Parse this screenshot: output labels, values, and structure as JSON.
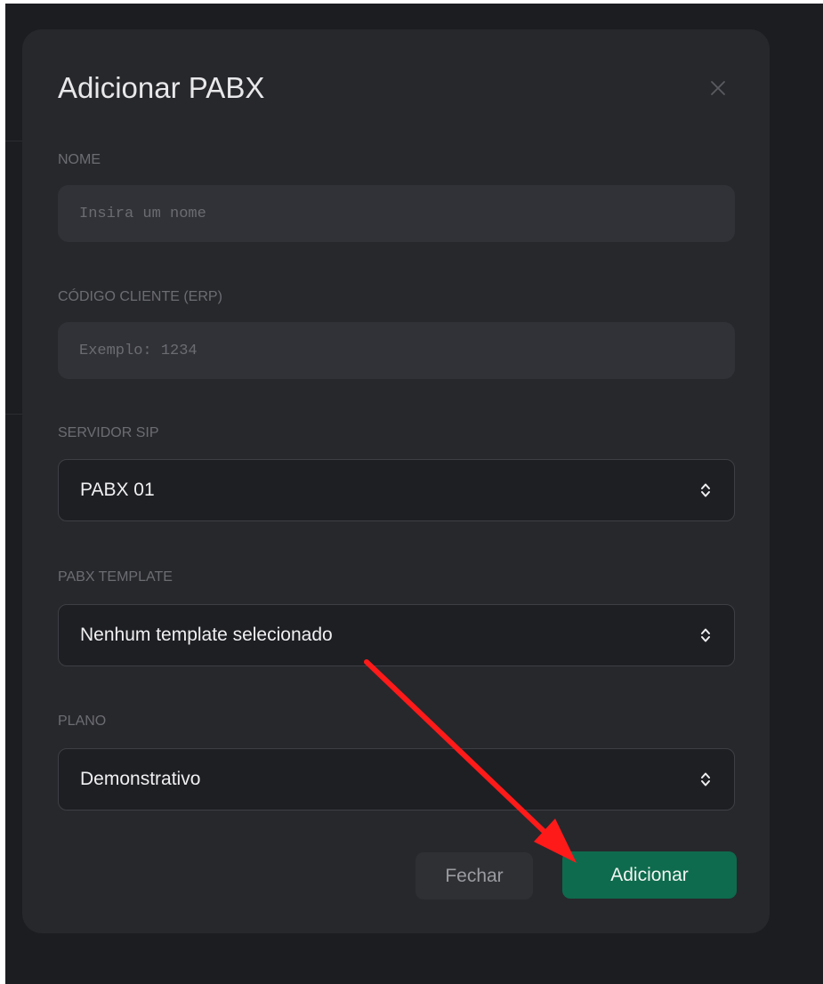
{
  "modal": {
    "title": "Adicionar PABX"
  },
  "form": {
    "nome": {
      "label": "NOME",
      "value": "",
      "placeholder": "Insira um nome"
    },
    "codigo_cliente": {
      "label": "CÓDIGO CLIENTE (ERP)",
      "value": "",
      "placeholder": "Exemplo: 1234"
    },
    "servidor_sip": {
      "label": "SERVIDOR SIP",
      "selected": "PABX 01"
    },
    "pabx_template": {
      "label": "PABX TEMPLATE",
      "selected": "Nenhum template selecionado"
    },
    "plano": {
      "label": "PLANO",
      "selected": "Demonstrativo"
    }
  },
  "actions": {
    "close_label": "Fechar",
    "submit_label": "Adicionar"
  },
  "colors": {
    "modal_background": "#27282c",
    "page_background": "#1c1d21",
    "primary_button": "#0e6b4d",
    "annotation_arrow": "#ff1a1a"
  },
  "icons": {
    "close": "close-icon",
    "select": "chevron-up-down-icon"
  }
}
